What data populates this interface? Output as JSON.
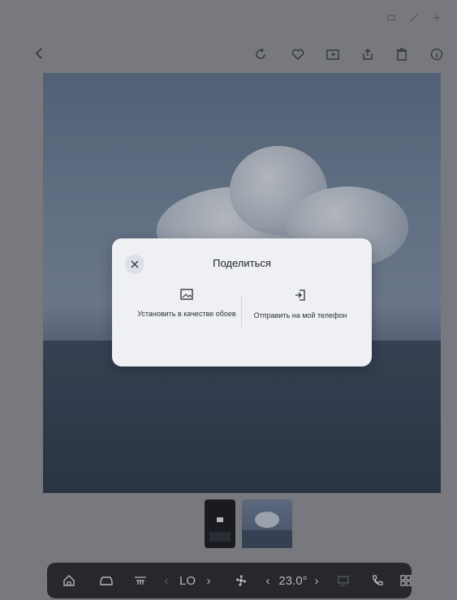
{
  "toolbar": {
    "back_icon": "chevron-left-icon",
    "actions": [
      "rotate-icon",
      "heart-icon",
      "folder-move-icon",
      "share-icon",
      "trash-icon",
      "info-icon"
    ]
  },
  "dialog": {
    "title": "Поделиться",
    "option_wallpaper_label": "Установить в качестве обоев",
    "option_phone_label": "Отправить на мой телефон"
  },
  "dock": {
    "fan_level": "LO",
    "fan_sub": "",
    "temperature": "23.0°"
  }
}
